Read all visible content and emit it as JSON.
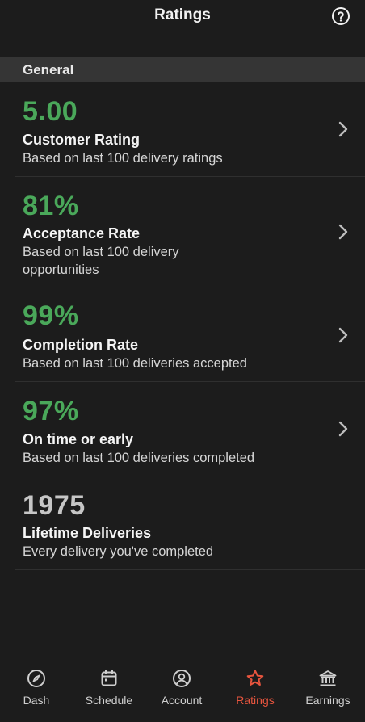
{
  "header": {
    "title": "Ratings",
    "help_icon": "help-circle-icon"
  },
  "section": {
    "label": "General"
  },
  "metrics": [
    {
      "value": "5.00",
      "title": "Customer Rating",
      "subtitle": "Based on last 100 delivery ratings",
      "color": "#4aa85a"
    },
    {
      "value": "81%",
      "title": "Acceptance Rate",
      "subtitle": "Based on last 100 delivery opportunities",
      "color": "#4aa85a"
    },
    {
      "value": "99%",
      "title": "Completion Rate",
      "subtitle": "Based on last 100 deliveries accepted",
      "color": "#4aa85a"
    },
    {
      "value": "97%",
      "title": "On time or early",
      "subtitle": "Based on last 100 deliveries completed",
      "color": "#4aa85a"
    },
    {
      "value": "1975",
      "title": "Lifetime Deliveries",
      "subtitle": "Every delivery you've completed",
      "color": "#c6c6c6"
    }
  ],
  "tabs": [
    {
      "label": "Dash",
      "icon": "compass-icon"
    },
    {
      "label": "Schedule",
      "icon": "calendar-icon"
    },
    {
      "label": "Account",
      "icon": "account-icon"
    },
    {
      "label": "Ratings",
      "icon": "star-icon",
      "active": true
    },
    {
      "label": "Earnings",
      "icon": "bank-icon"
    }
  ],
  "colors": {
    "background": "#1c1c1c",
    "section_header": "#353535",
    "accent_green": "#4aa85a",
    "active_tab": "#e8553e"
  }
}
